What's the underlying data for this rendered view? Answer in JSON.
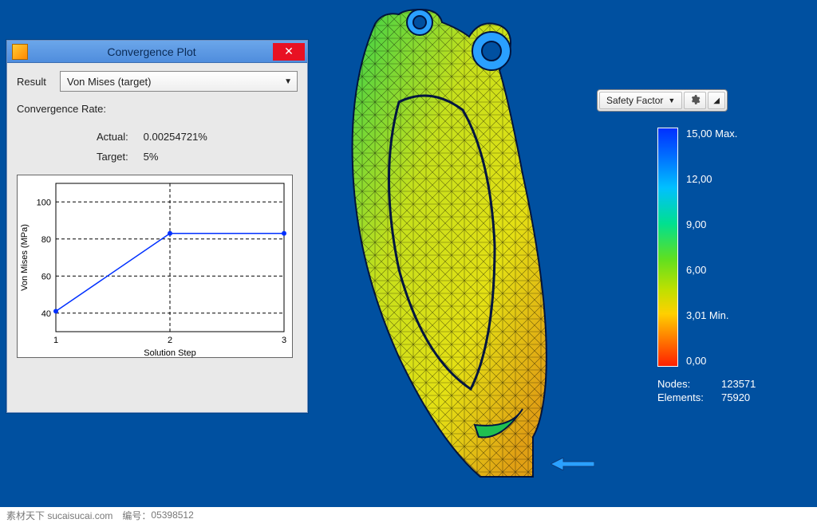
{
  "dialog": {
    "title": "Convergence Plot",
    "result_label": "Result",
    "result_value": "Von Mises (target)",
    "convergence_rate_label": "Convergence Rate:",
    "actual_label": "Actual:",
    "actual_value": "0.00254721%",
    "target_label": "Target:",
    "target_value": "5%"
  },
  "toolbar": {
    "mode_label": "Safety Factor"
  },
  "legend": {
    "ticks": [
      "15,00 Max.",
      "12,00",
      "9,00",
      "6,00",
      "3,01 Min.",
      "0,00"
    ],
    "nodes_label": "Nodes:",
    "nodes_value": "123571",
    "elements_label": "Elements:",
    "elements_value": "75920"
  },
  "watermark": {
    "left": "素材天下 sucaisucai.com",
    "id_label": "编号：",
    "id_value": "05398512"
  },
  "chart_data": {
    "type": "line",
    "title": "",
    "xlabel": "Solution Step",
    "ylabel": "Von Mises (MPa)",
    "x": [
      1,
      2,
      3
    ],
    "values": [
      41,
      83,
      83
    ],
    "xlim": [
      1,
      3
    ],
    "ylim": [
      30,
      110
    ],
    "yticks": [
      40,
      60,
      80,
      100
    ],
    "xticks": [
      1,
      2,
      3
    ]
  }
}
